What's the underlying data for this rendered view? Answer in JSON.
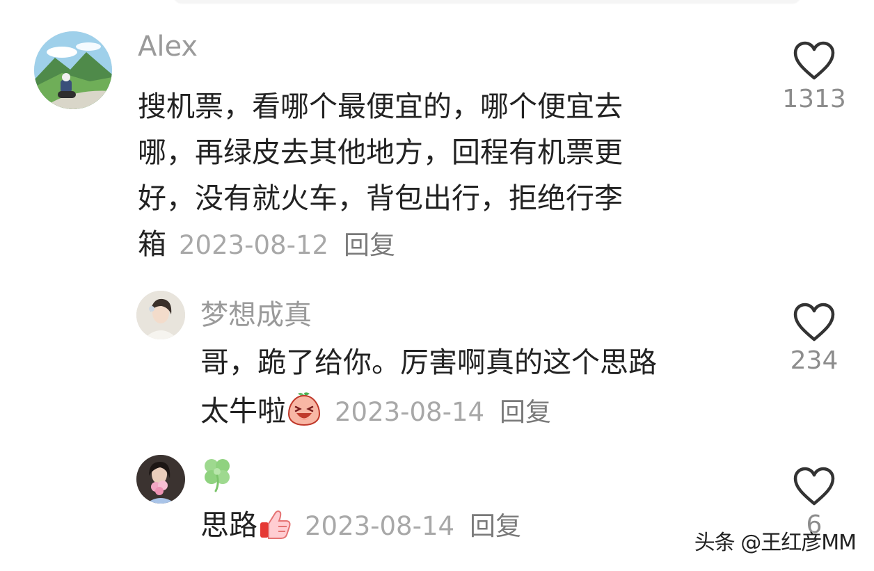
{
  "comments": [
    {
      "author": "Alex",
      "text_lines": [
        "搜机票，看哪个最便宜的，哪个便宜去",
        "哪，再绿皮去其他地方，回程有机票更",
        "好，没有就火车，背包出行，拒绝行李"
      ],
      "last_line": "箱",
      "date": "2023-08-12",
      "reply_label": "回复",
      "likes": "1313"
    },
    {
      "author": "梦想成真",
      "text_lines": [
        "哥，跪了给你。厉害啊真的这个思路"
      ],
      "last_line": "太牛啦",
      "emoji": "laughing-peach-emoji",
      "date": "2023-08-14",
      "reply_label": "回复",
      "likes": "234"
    },
    {
      "author_icon": "four-leaf-clover-icon",
      "last_line": "思路",
      "emoji": "thumbs-up-emoji",
      "date": "2023-08-14",
      "reply_label": "回复",
      "likes": "6"
    }
  ],
  "watermark": "头条 @王红彦MM",
  "colors": {
    "text": "#222222",
    "meta": "#a8a8a8",
    "author": "#9a9a9a",
    "heart_stroke": "#333333"
  }
}
